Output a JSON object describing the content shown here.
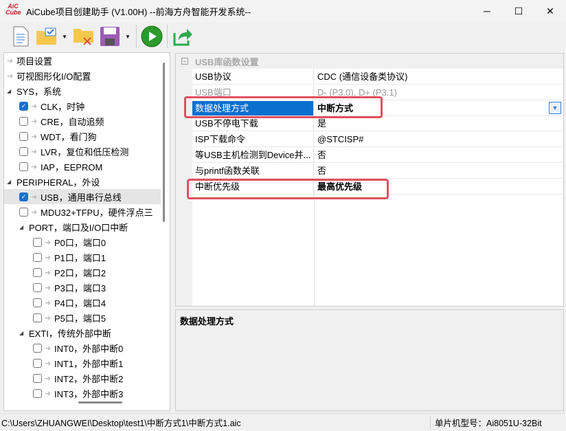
{
  "window": {
    "title": "AiCube项目创建助手 (V1.00H) --前海方舟智能开发系统--",
    "logo_text": "AiC Cube",
    "minimize": "─",
    "maximize": "☐",
    "close": "✕"
  },
  "toolbar": {
    "items": [
      "new-file-icon",
      "open-project-icon",
      "close-project-icon",
      "save-icon",
      "run-icon",
      "export-icon"
    ]
  },
  "tree": {
    "items": [
      {
        "label": "项目设置",
        "level": 0,
        "type": "leaf"
      },
      {
        "label": "可视图形化I/O配置",
        "level": 0,
        "type": "leaf"
      },
      {
        "label": "SYS，系统",
        "level": 0,
        "type": "group"
      },
      {
        "label": "CLK，时钟",
        "level": 1,
        "type": "check",
        "checked": true
      },
      {
        "label": "CRE，自动追频",
        "level": 1,
        "type": "check",
        "checked": false
      },
      {
        "label": "WDT，看门狗",
        "level": 1,
        "type": "check",
        "checked": false
      },
      {
        "label": "LVR，复位和低压检测",
        "level": 1,
        "type": "check",
        "checked": false
      },
      {
        "label": "IAP，EEPROM",
        "level": 1,
        "type": "check",
        "checked": false
      },
      {
        "label": "PERIPHERAL，外设",
        "level": 0,
        "type": "group"
      },
      {
        "label": "USB，通用串行总线",
        "level": 1,
        "type": "check",
        "checked": true,
        "selected": true
      },
      {
        "label": "MDU32+TFPU，硬件浮点三",
        "level": 1,
        "type": "check",
        "checked": false
      },
      {
        "label": "PORT，端口及I/O口中断",
        "level": 1,
        "type": "group"
      },
      {
        "label": "P0口，端口0",
        "level": 2,
        "type": "check",
        "checked": false
      },
      {
        "label": "P1口，端口1",
        "level": 2,
        "type": "check",
        "checked": false
      },
      {
        "label": "P2口，端口2",
        "level": 2,
        "type": "check",
        "checked": false
      },
      {
        "label": "P3口，端口3",
        "level": 2,
        "type": "check",
        "checked": false
      },
      {
        "label": "P4口，端口4",
        "level": 2,
        "type": "check",
        "checked": false
      },
      {
        "label": "P5口，端口5",
        "level": 2,
        "type": "check",
        "checked": false
      },
      {
        "label": "EXTI，传统外部中断",
        "level": 1,
        "type": "group"
      },
      {
        "label": "INT0，外部中断0",
        "level": 2,
        "type": "check",
        "checked": false
      },
      {
        "label": "INT1，外部中断1",
        "level": 2,
        "type": "check",
        "checked": false
      },
      {
        "label": "INT2，外部中断2",
        "level": 2,
        "type": "check",
        "checked": false
      },
      {
        "label": "INT3，外部中断3",
        "level": 2,
        "type": "check",
        "checked": false
      }
    ]
  },
  "grid": {
    "category": "USB库函数设置",
    "rows": [
      {
        "key": "USB协议",
        "value": "CDC (通信设备类协议)"
      },
      {
        "key": "USB端口",
        "value": "D- (P3.0), D+ (P3.1)",
        "disabled": true
      },
      {
        "key": "数据处理方式",
        "value": "中断方式",
        "selected": true,
        "bold": true
      },
      {
        "key": "USB不停电下载",
        "value": "是"
      },
      {
        "key": "ISP下载命令",
        "value": "@STCISP#"
      },
      {
        "key": "等USB主机检测到Device并...",
        "value": "否"
      },
      {
        "key": "与printf函数关联",
        "value": "否"
      },
      {
        "key": "中断优先级",
        "value": "最高优先级",
        "bold": true
      }
    ]
  },
  "description": {
    "title": "数据处理方式"
  },
  "status": {
    "path": "C:\\Users\\ZHUANGWEI\\Desktop\\test1\\中断方式1\\中断方式1.aic",
    "chip": "单片机型号：Ai8051U-32Bit"
  },
  "colors": {
    "selection": "#0a6fcf",
    "highlight": "#e0505f"
  }
}
